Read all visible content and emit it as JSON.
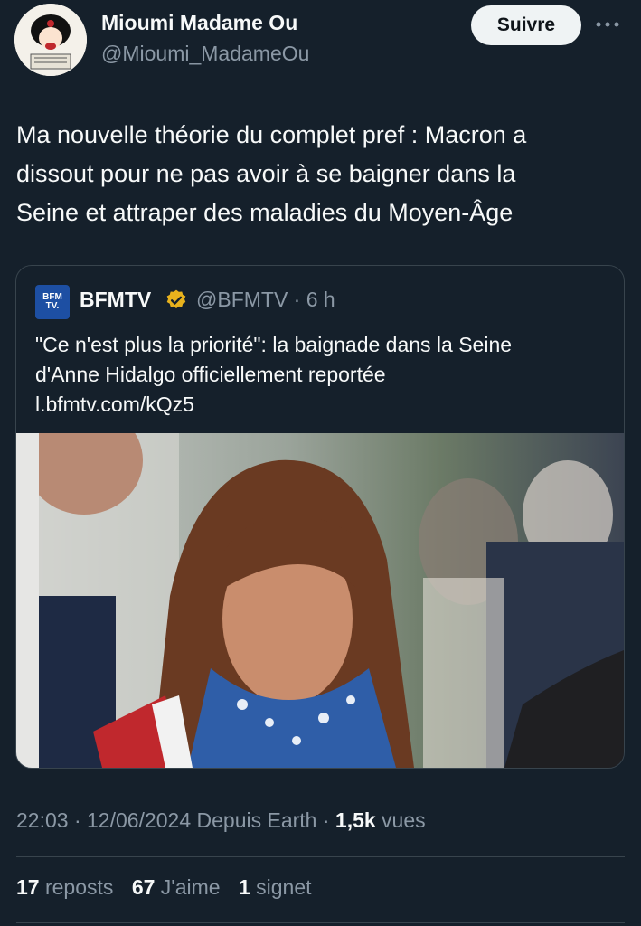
{
  "author": {
    "name": "Mioumi Madame Ou",
    "handle": "@Mioumi_MadameOu",
    "follow_label": "Suivre",
    "more_icon": "more-dots-icon"
  },
  "tweet": {
    "line1": "Ma nouvelle théorie du complet pref : Macron a",
    "line2": "dissout pour ne pas avoir à se baigner dans la",
    "line3": "Seine et attraper des maladies du Moyen-Âge"
  },
  "quote": {
    "logo_line1": "BFM",
    "logo_line2": "TV.",
    "name": "BFMTV",
    "handle_time": "@BFMTV · 6 h",
    "line1": "\"Ce n'est plus la priorité\": la baignade dans la Seine",
    "line2": "d'Anne Hidalgo officiellement reportée",
    "link": "l.bfmtv.com/kQz5",
    "colors": {
      "logo_bg": "#1d4fa3",
      "verified": "#e8b21d"
    }
  },
  "meta": {
    "time_date_source": "22:03 · 12/06/2024 Depuis Earth · ",
    "views_count": "1,5k",
    "views_label": " vues"
  },
  "stats": {
    "reposts_count": "17",
    "reposts_label": "reposts",
    "likes_count": "67",
    "likes_label": "J'aime",
    "bookmarks_count": "1",
    "bookmarks_label": "signet"
  },
  "colors": {
    "background": "#15202b",
    "text": "#f7f9f9",
    "secondary": "#8b98a5",
    "border": "#38444d"
  }
}
